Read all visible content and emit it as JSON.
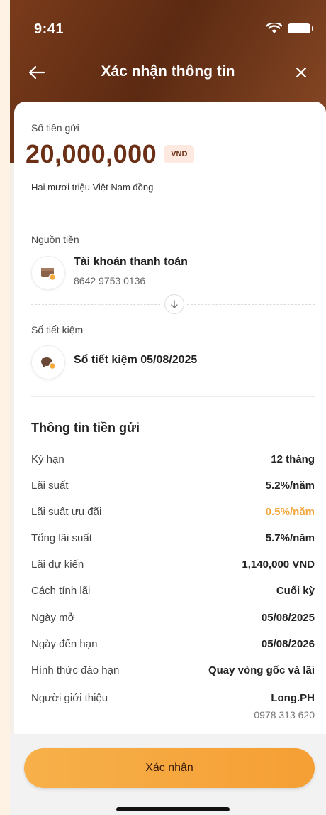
{
  "status": {
    "time": "9:41"
  },
  "nav": {
    "title": "Xác nhận thông tin"
  },
  "deposit": {
    "label": "Số tiền gửi",
    "amount": "20,000,000",
    "currency": "VND",
    "amount_words": "Hai mươi triệu Việt Nam đồng"
  },
  "source": {
    "label": "Nguồn tiền",
    "account_name": "Tài khoản thanh toán",
    "account_number": "8642 9753 0136"
  },
  "savings": {
    "label": "Số tiết kiệm",
    "name": "Sổ tiết kiệm 05/08/2025"
  },
  "details": {
    "title": "Thông tin tiền gửi",
    "rows": [
      {
        "label": "Kỳ hạn",
        "value": "12 tháng"
      },
      {
        "label": "Lãi suất",
        "value": "5.2%/năm"
      },
      {
        "label": "Lãi suất ưu đãi",
        "value": "0.5%/năm"
      },
      {
        "label": "Tổng lãi suất",
        "value": "5.7%/năm"
      },
      {
        "label": "Lãi dự kiến",
        "value": "1,140,000 VND"
      },
      {
        "label": "Cách tính lãi",
        "value": "Cuối kỳ"
      },
      {
        "label": "Ngày mở",
        "value": "05/08/2025"
      },
      {
        "label": "Ngày đến hạn",
        "value": "05/08/2026"
      },
      {
        "label": "Hình thức đáo hạn",
        "value": "Quay vòng gốc và lãi"
      },
      {
        "label": "Người giới thiệu",
        "value": "Long.PH",
        "sub": "0978 313 620"
      }
    ]
  },
  "actions": {
    "confirm_label": "Xác nhận"
  },
  "colors": {
    "brand_brown": "#6b3016",
    "accent_orange": "#f59f34",
    "highlight": "#f2a53a"
  },
  "icons": [
    "wifi-icon",
    "battery-icon",
    "back-arrow-icon",
    "close-icon",
    "wallet-icon",
    "down-arrow-icon",
    "piggy-bank-icon"
  ]
}
